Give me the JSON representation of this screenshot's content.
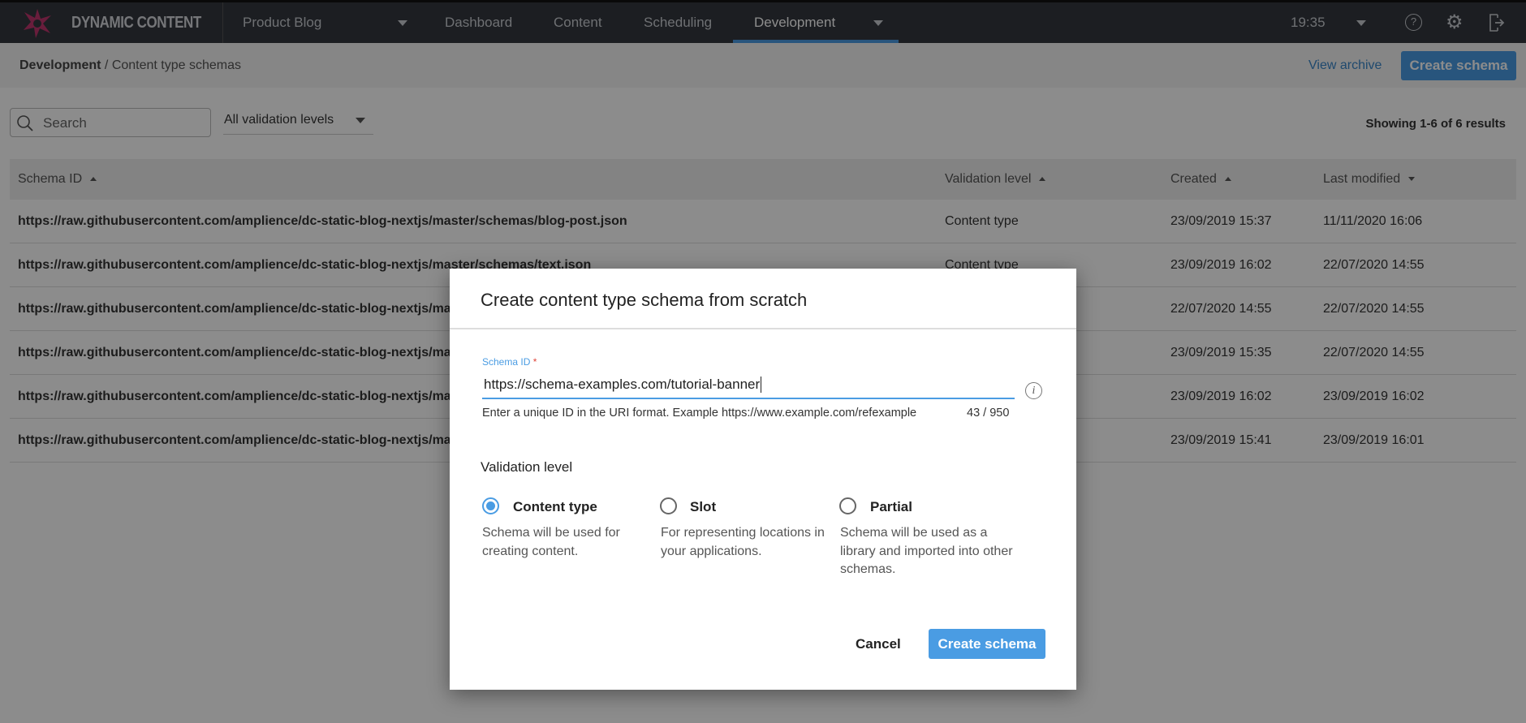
{
  "app": {
    "brand": "DYNAMIC CONTENT",
    "hub": "Product Blog",
    "nav": [
      "Dashboard",
      "Content",
      "Scheduling",
      "Development"
    ],
    "active_nav": "Development",
    "time": "19:35",
    "accent": "#4a9ce3"
  },
  "breadcrumb": {
    "root": "Development",
    "current": "/ Content type schemas"
  },
  "actions": {
    "view_archive": "View archive",
    "create_schema": "Create schema"
  },
  "filters": {
    "search_placeholder": "Search",
    "validation_filter": "All validation levels",
    "results": "Showing 1-6 of 6 results"
  },
  "table": {
    "headers": [
      "Schema ID",
      "Validation level",
      "Created",
      "Last modified"
    ],
    "rows": [
      {
        "id": "https://raw.githubusercontent.com/amplience/dc-static-blog-nextjs/master/schemas/blog-post.json",
        "level": "Content type",
        "created": "23/09/2019 15:37",
        "modified": "11/11/2020 16:06"
      },
      {
        "id": "https://raw.githubusercontent.com/amplience/dc-static-blog-nextjs/master/schemas/text.json",
        "level": "Content type",
        "created": "23/09/2019 16:02",
        "modified": "22/07/2020 14:55"
      },
      {
        "id": "https://raw.githubusercontent.com/amplience/dc-static-blog-nextjs/mas",
        "level": "",
        "created": "22/07/2020 14:55",
        "modified": "22/07/2020 14:55"
      },
      {
        "id": "https://raw.githubusercontent.com/amplience/dc-static-blog-nextjs/mas",
        "level": "",
        "created": "23/09/2019 15:35",
        "modified": "22/07/2020 14:55"
      },
      {
        "id": "https://raw.githubusercontent.com/amplience/dc-static-blog-nextjs/mas",
        "level": "",
        "created": "23/09/2019 16:02",
        "modified": "23/09/2019 16:02"
      },
      {
        "id": "https://raw.githubusercontent.com/amplience/dc-static-blog-nextjs/mas",
        "level": "",
        "created": "23/09/2019 15:41",
        "modified": "23/09/2019 16:01"
      }
    ]
  },
  "modal": {
    "title": "Create content type schema from scratch",
    "field_label": "Schema ID",
    "required_mark": "*",
    "field_value": "https://schema-examples.com/tutorial-banner",
    "helper": "Enter a unique ID in the URI format. Example https://www.example.com/refexample",
    "counter": "43 / 950",
    "validation_heading": "Validation level",
    "options": [
      {
        "label": "Content type",
        "desc": "Schema will be used for creating content.",
        "selected": true
      },
      {
        "label": "Slot",
        "desc": "For representing locations in your applications.",
        "selected": false
      },
      {
        "label": "Partial",
        "desc": "Schema will be used as a library and imported into other schemas.",
        "selected": false
      }
    ],
    "cancel": "Cancel",
    "submit": "Create schema"
  }
}
